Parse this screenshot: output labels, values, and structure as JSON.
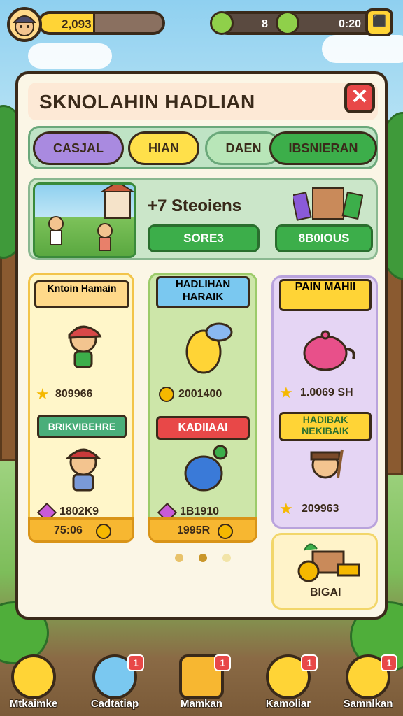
{
  "hud": {
    "xp_value": "2,093",
    "xp_progress": 0.45,
    "resource_a": "8",
    "resource_b": "0:20"
  },
  "panel": {
    "title": "SKNOLAHIN HADLIAN",
    "close_label": "✕",
    "tabs": [
      {
        "label": "CASJAL",
        "color": "#a98ae0"
      },
      {
        "label": "HIAN",
        "color": "#ffe04a"
      },
      {
        "label": "DAEN",
        "color": "#b8e6b8"
      },
      {
        "label": "IBSNIERAN",
        "color": "#3cae4a"
      }
    ],
    "banner": {
      "title": "+7 Steoiens",
      "btn_left": "SORE3",
      "btn_right": "8B0IOUS"
    }
  },
  "cards": {
    "yellow": {
      "header": "Kntoin Hamain",
      "value1": "809966",
      "ribbon": "BRIKVIBEHRE",
      "value2": "1802K9",
      "footer": "75:06"
    },
    "green": {
      "header": "HADLIHAN HARAIK",
      "value1": "2001400",
      "ribbon": "KADIIAAI",
      "value2": "1B1910",
      "footer": "1995R"
    },
    "purple": {
      "header": "PAIN MAHII",
      "value1": "1.0069 SH",
      "ribbon": "HADIBAK NEKIBAIK",
      "value2": "209963"
    },
    "bonus": {
      "label": "BIGAI"
    }
  },
  "pagination": {
    "count": 3,
    "active": 1
  },
  "nav": [
    {
      "label": "Mtkaimke",
      "badge": ""
    },
    {
      "label": "Cadtatiap",
      "badge": "1"
    },
    {
      "label": "Mamkan",
      "badge": "1"
    },
    {
      "label": "Kamoliar",
      "badge": "1"
    },
    {
      "label": "Samnlkan",
      "badge": "1"
    }
  ],
  "colors": {
    "panel_bg": "#fbf6e6",
    "outline": "#3a2a1a",
    "accent_yellow": "#ffd436",
    "accent_green": "#3cae4a",
    "close_red": "#e84848"
  }
}
